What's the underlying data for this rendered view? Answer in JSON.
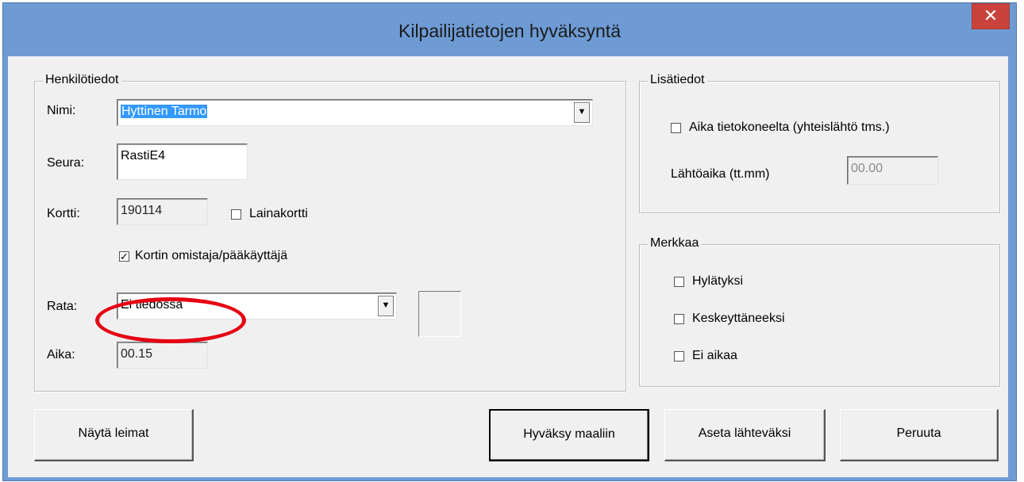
{
  "window": {
    "title": "Kilpailijatietojen hyväksyntä",
    "close_glyph": "✕"
  },
  "henkilotiedot": {
    "legend": "Henkilötiedot",
    "nimi_label": "Nimi:",
    "nimi_value": "Hyttinen Tarmo",
    "seura_label": "Seura:",
    "seura_value": "RastiE4",
    "kortti_label": "Kortti:",
    "kortti_value": "190114",
    "lainakortti_label": "Lainakortti",
    "lainakortti_checked": false,
    "omistaja_label": "Kortin omistaja/pääkäyttäjä",
    "omistaja_checked": true,
    "rata_label": "Rata:",
    "rata_value": "Ei tiedossa",
    "aika_label": "Aika:",
    "aika_value": "00.15"
  },
  "lisatiedot": {
    "legend": "Lisätiedot",
    "aika_tietokone_label": "Aika tietokoneelta (yhteislähtö tms.)",
    "aika_tietokone_checked": false,
    "lahtoaika_label": "Lähtöaika (tt.mm)",
    "lahtoaika_value": "00.00"
  },
  "merkkaa": {
    "legend": "Merkkaa",
    "hylatyksi": "Hylätyksi",
    "keskeyttaneeksi": "Keskeyttäneeksi",
    "ei_aikaa": "Ei aikaa"
  },
  "buttons": {
    "nayta_leimat": "Näytä leimat",
    "hyvaksy_maaliin": "Hyväksy maaliin",
    "aseta_lahteveksi": "Aseta lähteväksi",
    "peruuta": "Peruuta"
  },
  "annotation": {
    "color": "#e60012"
  }
}
